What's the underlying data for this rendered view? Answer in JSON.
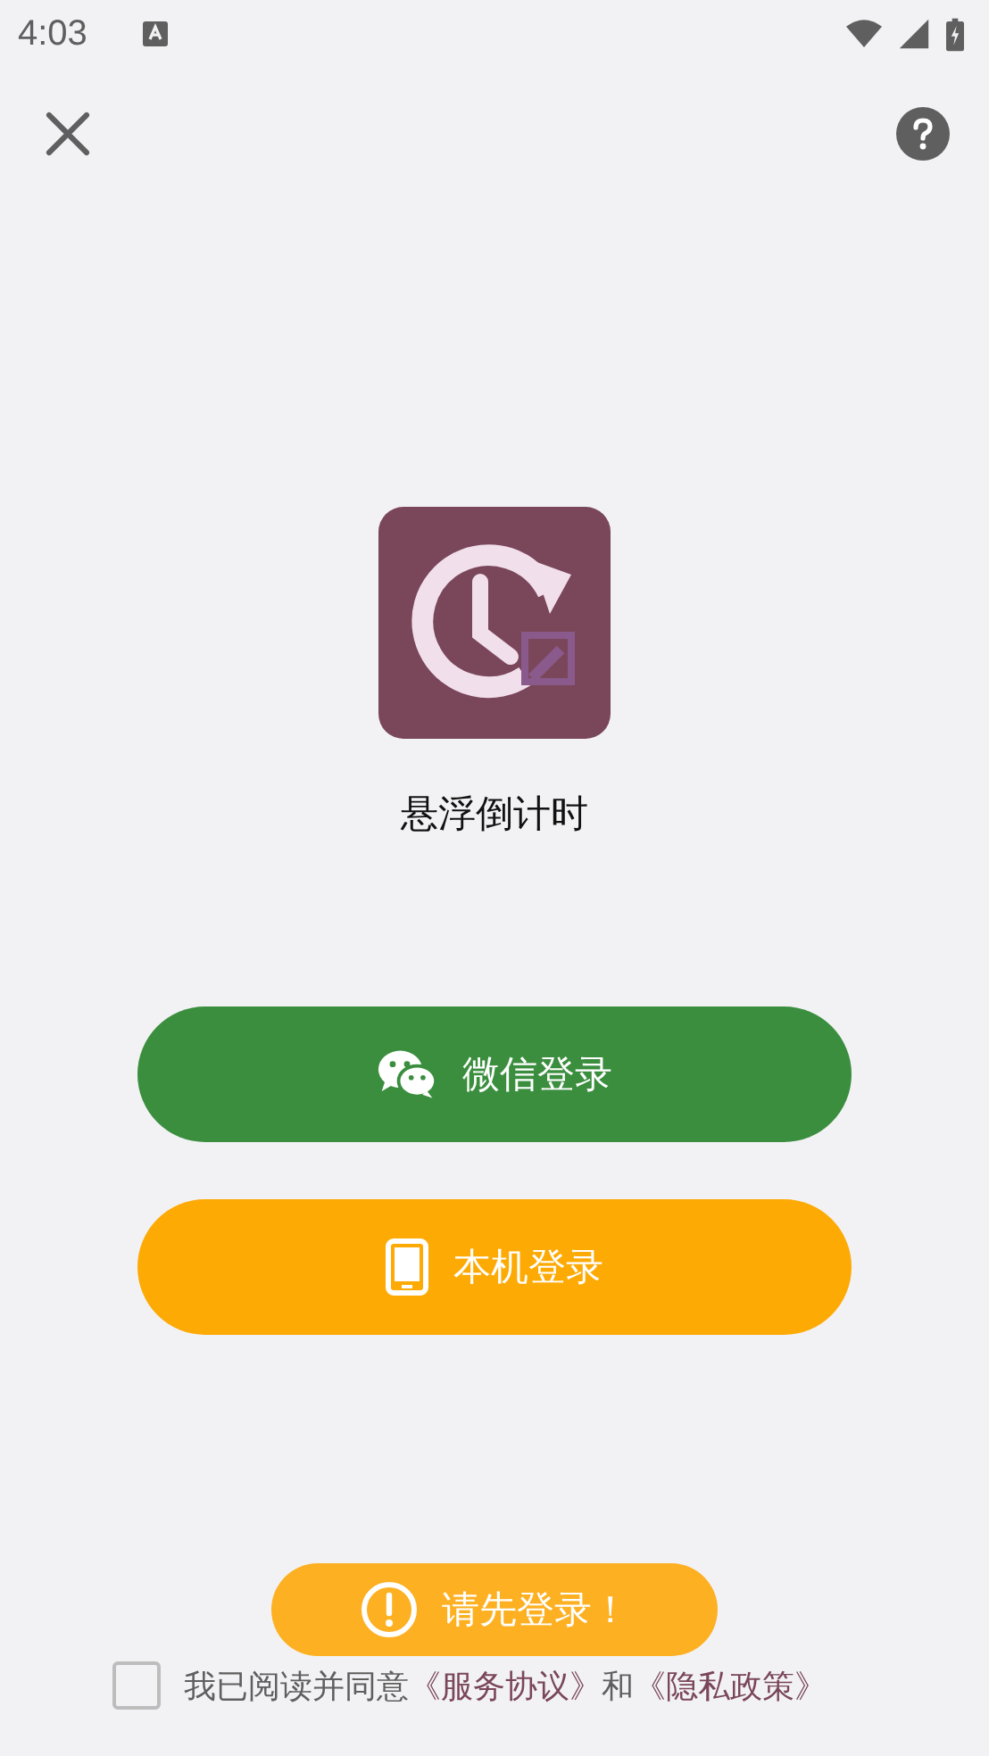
{
  "status_bar": {
    "time": "4:03"
  },
  "app": {
    "name": "悬浮倒计时"
  },
  "login_buttons": [
    {
      "kind": "wechat",
      "label": "微信登录"
    },
    {
      "kind": "device",
      "label": "本机登录"
    }
  ],
  "agreement": {
    "checked": false,
    "text": "我已阅读并同意",
    "links": [
      "《服务协议》",
      "《隐私政策》"
    ],
    "joiner": "和"
  },
  "toast": {
    "message": "请先登录！"
  }
}
